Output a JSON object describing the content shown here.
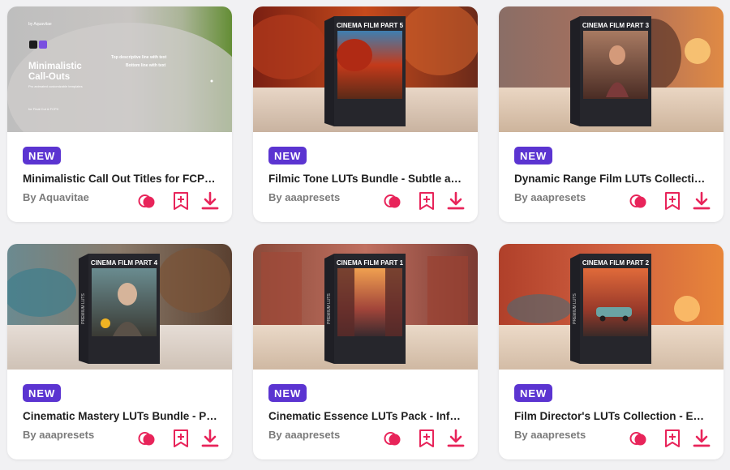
{
  "colors": {
    "badge": "#5b34d1",
    "action": "#e8245a"
  },
  "icons": {
    "compare": "overlapping-circles-icon",
    "bookmark": "bookmark-add-icon",
    "download": "download-icon"
  },
  "cards": [
    {
      "badge": "NEW",
      "title": "Minimalistic Call Out Titles for FCPX...",
      "author": "By Aquavitae",
      "thumb": {
        "corner_text": "by Aquavitae",
        "heading_line1": "Minimalistic",
        "heading_line2": "Call-Outs",
        "sub": "Pro animated customizable templates",
        "line1": "Top descriptive line with text",
        "line2": "Bottom line with text",
        "footer": "for Final Cut & FCPX"
      }
    },
    {
      "badge": "NEW",
      "title": "Filmic Tone LUTs Bundle - Subtle an...",
      "author": "By aaapresets",
      "box_title": "CINEMA FILM PART 5"
    },
    {
      "badge": "NEW",
      "title": "Dynamic Range Film LUTs Collectio...",
      "author": "By aaapresets",
      "box_title": "CINEMA FILM PART 3"
    },
    {
      "badge": "NEW",
      "title": "Cinematic Mastery LUTs Bundle - Pr...",
      "author": "By aaapresets",
      "box_title": "CINEMA FILM PART 4",
      "spine": "PREMIUM LUTS"
    },
    {
      "badge": "NEW",
      "title": "Cinematic Essence LUTs Pack - Infus...",
      "author": "By aaapresets",
      "box_title": "CINEMA FILM PART 1",
      "spine": "PREMIUM LUTS"
    },
    {
      "badge": "NEW",
      "title": "Film Director's LUTs Collection - Ess...",
      "author": "By aaapresets",
      "box_title": "CINEMA FILM PART 2",
      "spine": "PREMIUM LUTS"
    }
  ]
}
